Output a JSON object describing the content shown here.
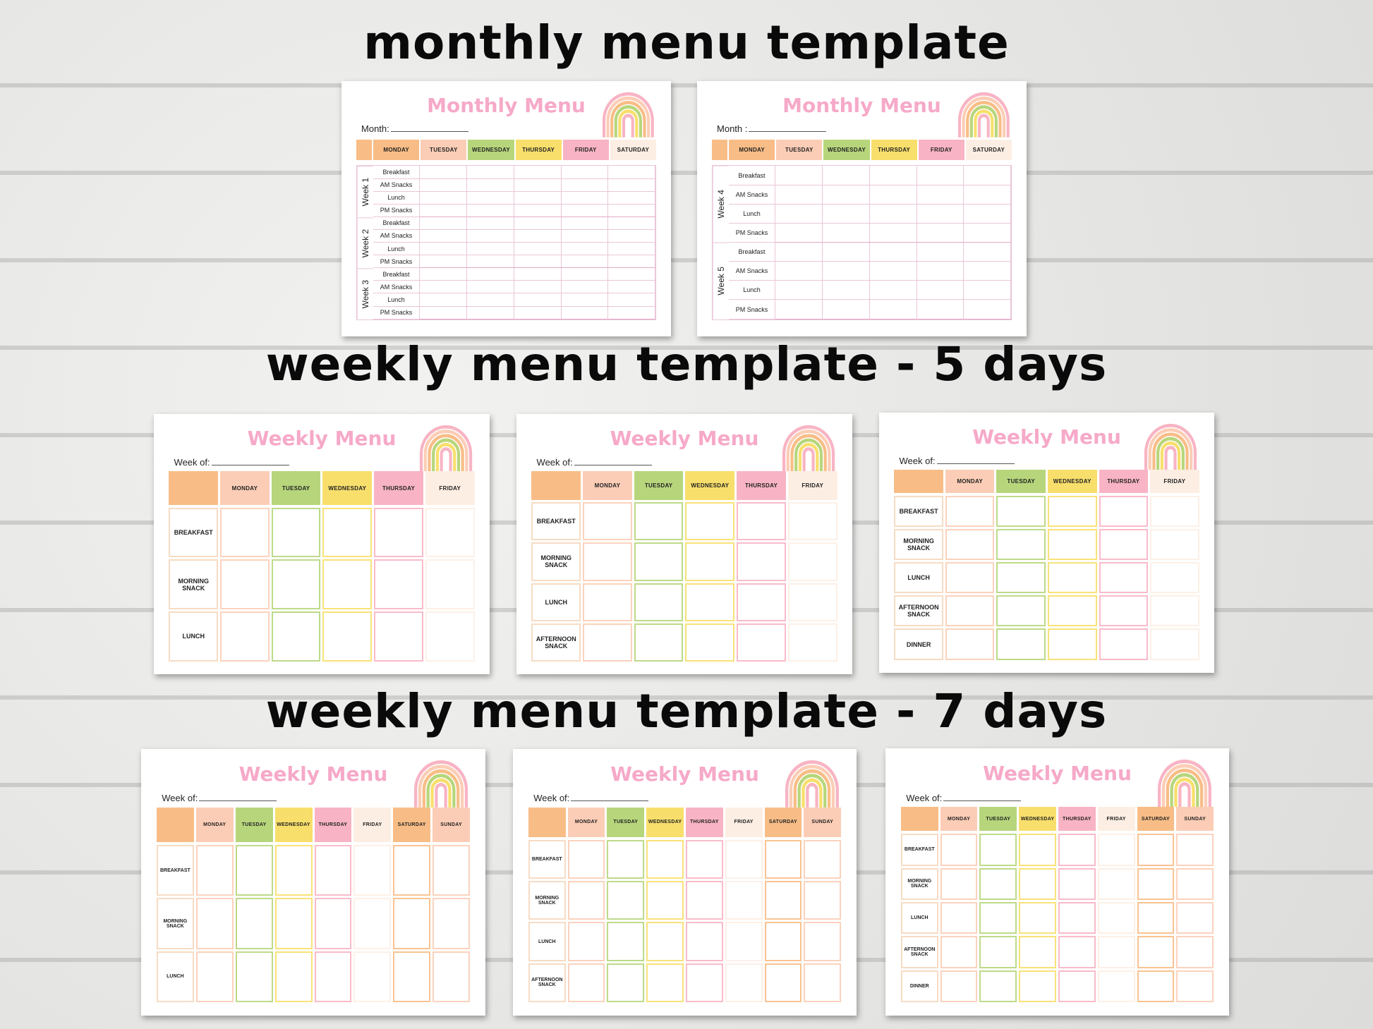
{
  "sections": [
    {
      "title": "monthly menu template"
    },
    {
      "title": "weekly menu template - 5 days"
    },
    {
      "title": "weekly menu template - 7 days"
    }
  ],
  "colors": {
    "title_pink": "#f6a9c8",
    "orange": "#f8bd86",
    "peach": "#fccdb6",
    "green": "#b7d67c",
    "yellow": "#f8df6c",
    "pink": "#f8b4c4",
    "cream": "#fdeee3"
  },
  "cards": [
    {
      "type": "monthly",
      "title": "Monthly Menu",
      "field_label": "Month:",
      "days": [
        "MONDAY",
        "TUESDAY",
        "WEDNESDAY",
        "THURSDAY",
        "FRIDAY",
        "SATURDAY"
      ],
      "weeks": [
        {
          "label": "Week 1",
          "meals": [
            "Breakfast",
            "AM Snacks",
            "Lunch",
            "PM Snacks"
          ]
        },
        {
          "label": "Week 2",
          "meals": [
            "Breakfast",
            "AM Snacks",
            "Lunch",
            "PM Snacks"
          ]
        },
        {
          "label": "Week 3",
          "meals": [
            "Breakfast",
            "AM Snacks",
            "Lunch",
            "PM Snacks"
          ]
        }
      ]
    },
    {
      "type": "monthly",
      "title": "Monthly Menu",
      "field_label": "Month :",
      "days": [
        "MONDAY",
        "TUESDAY",
        "WEDNESDAY",
        "THURSDAY",
        "FRIDAY",
        "SATURDAY"
      ],
      "weeks": [
        {
          "label": "Week 4",
          "meals": [
            "Breakfast",
            "AM Snacks",
            "Lunch",
            "PM Snacks"
          ]
        },
        {
          "label": "Week 5",
          "meals": [
            "Breakfast",
            "AM Snacks",
            "Lunch",
            "PM Snacks"
          ]
        }
      ]
    },
    {
      "type": "weekly",
      "title": "Weekly Menu",
      "field_label": "Week of:",
      "days": [
        "MONDAY",
        "TUESDAY",
        "WEDNESDAY",
        "THURSDAY",
        "FRIDAY"
      ],
      "meals": [
        "BREAKFAST",
        "MORNING SNACK",
        "LUNCH"
      ]
    },
    {
      "type": "weekly",
      "title": "Weekly Menu",
      "field_label": "Week of:",
      "days": [
        "MONDAY",
        "TUESDAY",
        "WEDNESDAY",
        "THURSDAY",
        "FRIDAY"
      ],
      "meals": [
        "BREAKFAST",
        "MORNING SNACK",
        "LUNCH",
        "AFTERNOON SNACK"
      ]
    },
    {
      "type": "weekly",
      "title": "Weekly Menu",
      "field_label": "Week of:",
      "days": [
        "MONDAY",
        "TUESDAY",
        "WEDNESDAY",
        "THURSDAY",
        "FRIDAY"
      ],
      "meals": [
        "BREAKFAST",
        "MORNING SNACK",
        "LUNCH",
        "AFTERNOON SNACK",
        "DINNER"
      ]
    },
    {
      "type": "weekly",
      "title": "Weekly Menu",
      "field_label": "Week of:",
      "days": [
        "MONDAY",
        "TUESDAY",
        "WEDNESDAY",
        "THURSDAY",
        "FRIDAY",
        "SATURDAY",
        "SUNDAY"
      ],
      "meals": [
        "BREAKFAST",
        "MORNING SNACK",
        "LUNCH"
      ]
    },
    {
      "type": "weekly",
      "title": "Weekly Menu",
      "field_label": "Week of:",
      "days": [
        "MONDAY",
        "TUESDAY",
        "WEDNESDAY",
        "THURSDAY",
        "FRIDAY",
        "SATURDAY",
        "SUNDAY"
      ],
      "meals": [
        "BREAKFAST",
        "MORNING SNACK",
        "LUNCH",
        "AFTERNOON SNACK"
      ]
    },
    {
      "type": "weekly",
      "title": "Weekly Menu",
      "field_label": "Week of:",
      "days": [
        "MONDAY",
        "TUESDAY",
        "WEDNESDAY",
        "THURSDAY",
        "FRIDAY",
        "SATURDAY",
        "SUNDAY"
      ],
      "meals": [
        "BREAKFAST",
        "MORNING SNACK",
        "LUNCH",
        "AFTERNOON SNACK",
        "DINNER"
      ]
    }
  ]
}
